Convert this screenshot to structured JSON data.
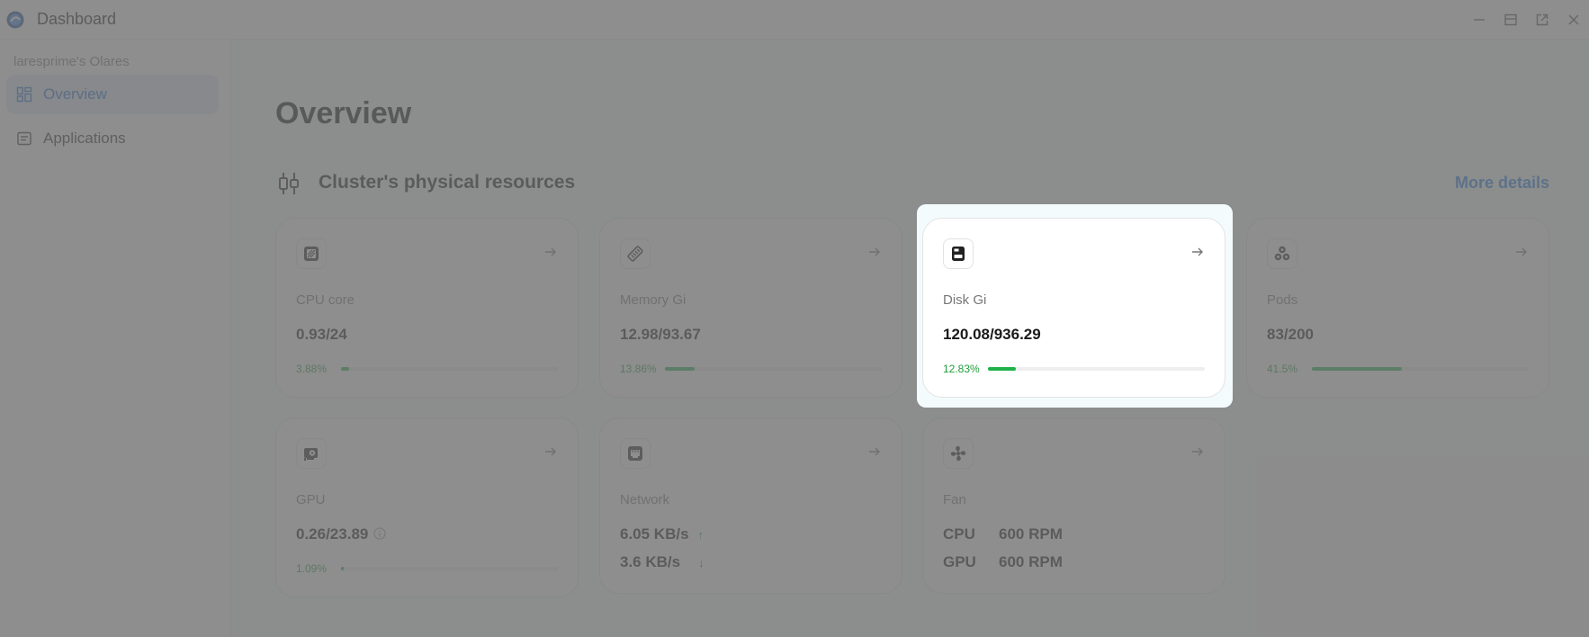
{
  "window": {
    "title": "Dashboard",
    "controls": [
      "minimize-icon",
      "restore-icon",
      "popout-icon",
      "close-icon"
    ]
  },
  "sidebar": {
    "owner": "laresprime's Olares",
    "items": [
      {
        "label": "Overview",
        "icon": "grid-icon",
        "active": true
      },
      {
        "label": "Applications",
        "icon": "app-list-icon",
        "active": false
      }
    ]
  },
  "main": {
    "title": "Overview",
    "section": {
      "title": "Cluster's physical resources",
      "more_details": "More details"
    },
    "cards": {
      "cpu": {
        "label": "CPU core",
        "value": "0.93/24",
        "percent": "3.88%",
        "fill": 0.0388,
        "icon": "cpu-icon"
      },
      "memory": {
        "label": "Memory Gi",
        "value": "12.98/93.67",
        "percent": "13.86%",
        "fill": 0.1386,
        "icon": "memory-icon"
      },
      "disk": {
        "label": "Disk Gi",
        "value": "120.08/936.29",
        "percent": "12.83%",
        "fill": 0.1283,
        "icon": "disk-icon"
      },
      "pods": {
        "label": "Pods",
        "value": "83/200",
        "percent": "41.5%",
        "fill": 0.415,
        "icon": "pods-icon"
      },
      "gpu": {
        "label": "GPU",
        "value": "0.26/23.89",
        "percent": "1.09%",
        "fill": 0.0109,
        "icon": "gpu-icon"
      },
      "network": {
        "label": "Network",
        "upload": "6.05 KB/s",
        "download": "3.6 KB/s",
        "icon": "network-icon"
      },
      "fan": {
        "label": "Fan",
        "cpu_name": "CPU",
        "cpu_value": "600 RPM",
        "gpu_name": "GPU",
        "gpu_value": "600 RPM",
        "icon": "fan-icon"
      }
    }
  },
  "colors": {
    "accent": "#1f7fe6",
    "progress": "#1fb24a",
    "up_arrow": "#1f9d3a",
    "down_arrow": "#e03131"
  }
}
